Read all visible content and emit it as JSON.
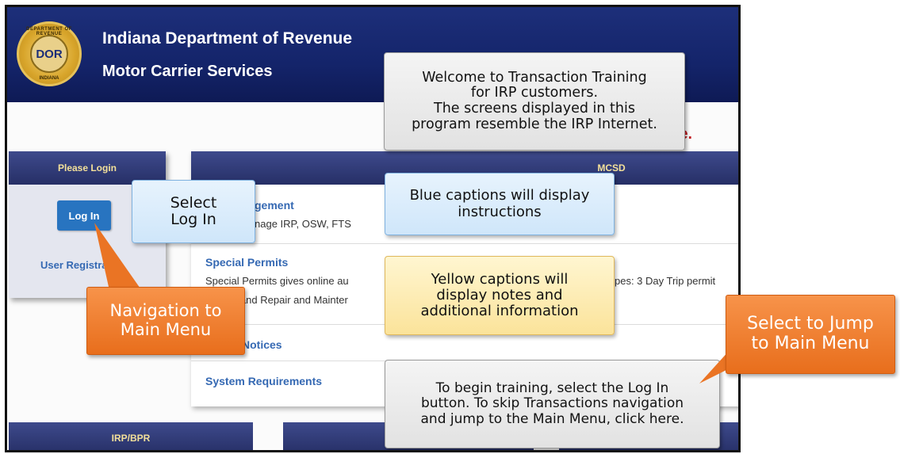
{
  "header": {
    "org_title": "Indiana Department of Revenue",
    "sub_title": "Motor Carrier Services",
    "seal": {
      "abbrev": "DOR",
      "ring_text": "DEPARTMENT OF REVENUE",
      "state": "INDIANA"
    }
  },
  "welcome_fragment": "e.",
  "login_panel": {
    "header": "Please Login",
    "login_button": "Log In",
    "user_registration": "User Registra"
  },
  "main_panel": {
    "header": "MCSD",
    "items": [
      {
        "link": "gement",
        "desc": "nage IRP, OSW, FTS"
      },
      {
        "link": "Special Permits",
        "desc": "Special Permits gives online au",
        "desc2": "r and Repair and Mainter",
        "desc_right": "pes: 3 Day Trip permit"
      },
      {
        "link": "Notices"
      },
      {
        "link": "System Requirements"
      }
    ]
  },
  "bottom_tabs": [
    "IRP/BPR"
  ],
  "captions": {
    "welcome": [
      "Welcome to Transaction Training",
      "for IRP customers.",
      "The screens displayed in this",
      "program resemble the IRP Internet."
    ],
    "select_login": [
      "Select",
      "Log In"
    ],
    "blue_info": [
      "Blue captions will display",
      "instructions"
    ],
    "yellow_info": [
      "Yellow captions will",
      "display notes and",
      "additional information"
    ],
    "nav_main": [
      "Navigation to",
      "Main Menu"
    ],
    "jump_main": [
      "Select to Jump",
      "to Main Menu"
    ],
    "begin": [
      "To begin training, select the Log In",
      "button. To skip Transactions navigation",
      "and jump to the Main Menu, click here."
    ]
  },
  "colors": {
    "header_blue": "#14246a",
    "login_button": "#2874c0",
    "link_blue": "#3569b3",
    "caption_orange": "#e86e1c",
    "caption_blue": "#cfe6fa",
    "caption_yellow": "#fbe39a",
    "welcome_red": "#c0161b"
  }
}
